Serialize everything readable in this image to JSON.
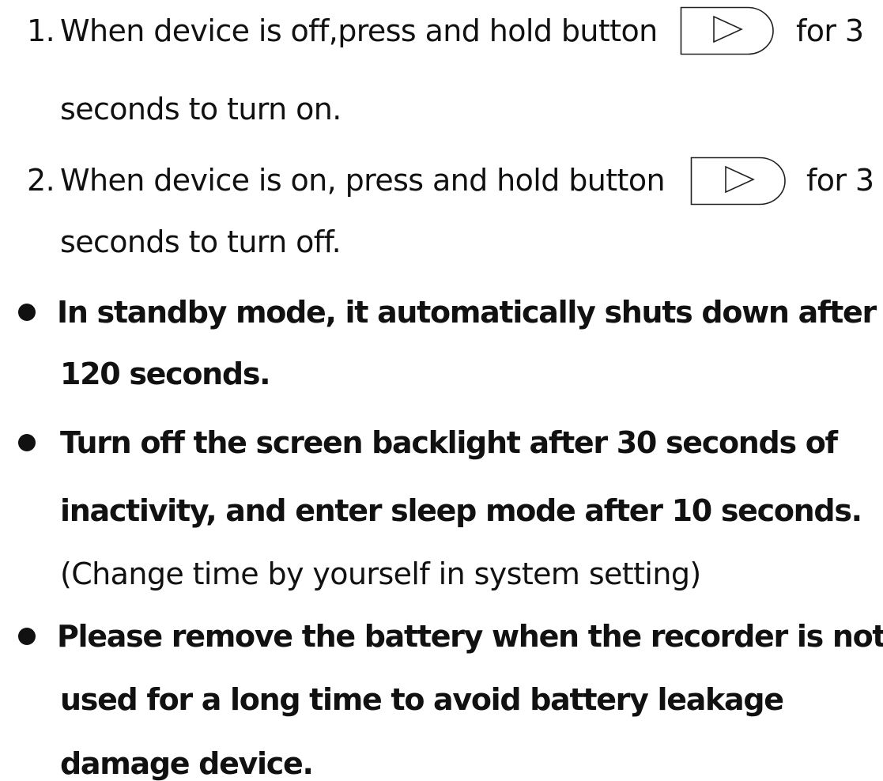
{
  "instructions": {
    "steps": [
      {
        "number": "1.",
        "text_before_icon": "When device is off,press and hold button",
        "text_after_icon": "for 3",
        "continuation": "seconds to turn on.",
        "icon": "play-button-icon"
      },
      {
        "number": "2.",
        "text_before_icon": "When device is on, press and hold button",
        "text_after_icon": "for 3",
        "continuation": "seconds to turn off.",
        "icon": "play-button-icon"
      }
    ],
    "notes": [
      {
        "lines": [
          "In standby mode, it automatically shuts down after",
          "120 seconds."
        ]
      },
      {
        "lines": [
          "Turn off the screen backlight after 30 seconds of",
          "inactivity, and enter sleep mode after 10 seconds."
        ],
        "aside": "(Change time by yourself in system setting)"
      },
      {
        "lines": [
          "Please remove the battery when the recorder is not",
          "used for a long time to avoid battery leakage",
          "damage device."
        ]
      }
    ]
  }
}
